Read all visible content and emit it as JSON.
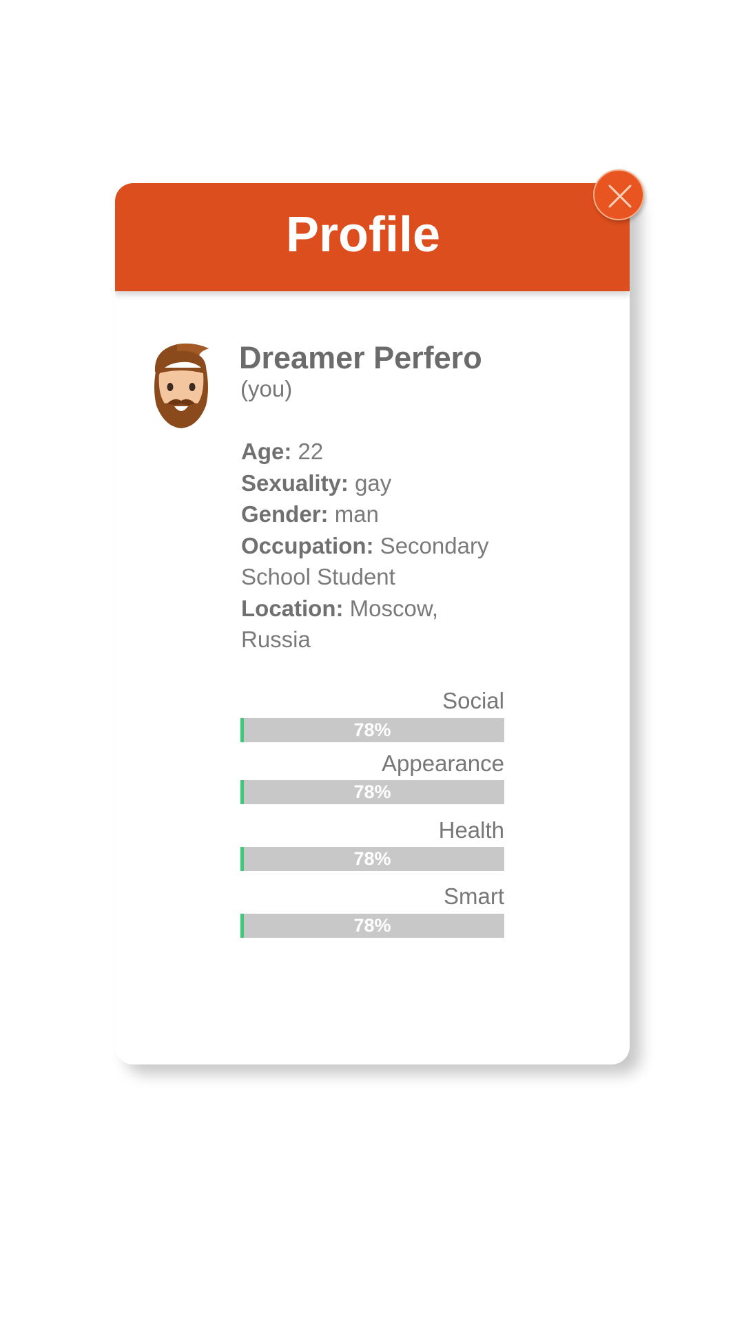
{
  "dialog": {
    "title": "Profile",
    "close_icon": "close-icon"
  },
  "profile": {
    "avatar_icon": "bearded-man-avatar-icon",
    "name": "Dreamer Perfero",
    "you_label": "(you)",
    "details": [
      {
        "key": "Age:",
        "value": " 22"
      },
      {
        "key": "Sexuality:",
        "value": " gay"
      },
      {
        "key": "Gender:",
        "value": " man"
      },
      {
        "key": "Occupation:",
        "value": " Secondary School Student"
      },
      {
        "key": "Location:",
        "value": " Moscow, Russia"
      }
    ]
  },
  "stats": [
    {
      "label": "Social",
      "value_text": "78%",
      "value": 78
    },
    {
      "label": "Appearance",
      "value_text": "78%",
      "value": 78
    },
    {
      "label": "Health",
      "value_text": "78%",
      "value": 78
    },
    {
      "label": "Smart",
      "value_text": "78%",
      "value": 78
    }
  ],
  "colors": {
    "header": "#dc4e1d",
    "close_button": "#e85521",
    "bar_track": "#c8c8c8",
    "bar_accent": "#3ec97a",
    "text": "#777777"
  }
}
